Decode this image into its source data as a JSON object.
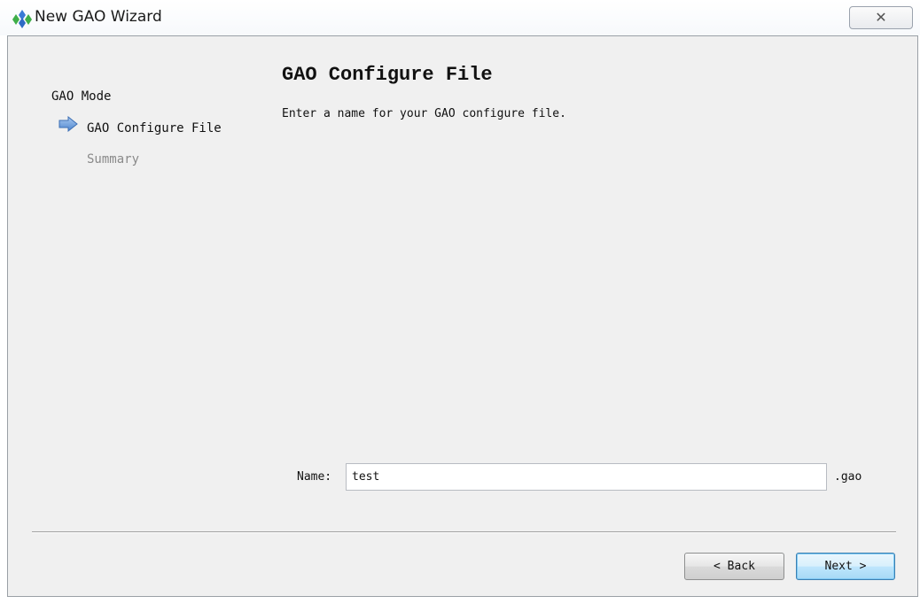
{
  "window": {
    "title": "New GAO Wizard",
    "close_glyph": "✕"
  },
  "steps": [
    {
      "label": "GAO Mode",
      "state": "done"
    },
    {
      "label": "GAO Configure File",
      "state": "current"
    },
    {
      "label": "Summary",
      "state": "pending"
    }
  ],
  "page": {
    "title": "GAO Configure File",
    "description": "Enter a name for your GAO configure file."
  },
  "form": {
    "name_label": "Name:",
    "name_value": "test",
    "extension": ".gao"
  },
  "buttons": {
    "back_label": "< Back",
    "next_label": "Next >"
  },
  "icons": {
    "app": "gowin-logo-icon",
    "current_step": "arrow-right-icon",
    "close": "close-icon"
  },
  "colors": {
    "arrow_fill": "#6e9fd8",
    "next_border": "#3c7fb1",
    "logo_blue": "#3a7bd5",
    "logo_green": "#3fae49"
  }
}
